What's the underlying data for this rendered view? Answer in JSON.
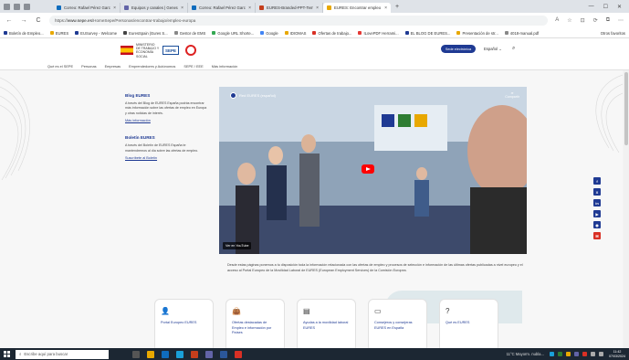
{
  "browser": {
    "tabs": [
      {
        "label": "Correo: Rafael Pérez García - Ou",
        "color": "#0f6cbd"
      },
      {
        "label": "Equipos y canales | General | Mi",
        "color": "#6264a7"
      },
      {
        "label": "Correo: Rafael Pérez García - Ou",
        "color": "#0f6cbd"
      },
      {
        "label": "EURES-Branded-PPT-Template-E",
        "color": "#c43e1c"
      },
      {
        "label": "EURES: Encontrar empleo en Eur",
        "color": "#e8a800",
        "active": true
      }
    ],
    "new_tab": "+",
    "window_controls": [
      "—",
      "☐",
      "✕"
    ],
    "nav": {
      "back": "←",
      "forward": "→",
      "reload": "C"
    },
    "url_prefix": "https://",
    "url_domain": "www.sepe.es",
    "url_path": "/HomeSepe/Personas/encontrar-trabajo/empleo-europa",
    "addr_icons": [
      "A",
      "☆",
      "⊡",
      "⟳",
      "⧉",
      "⋯"
    ],
    "bookmarks": [
      {
        "label": "Boletín de Empleo...",
        "color": "#1f3a93"
      },
      {
        "label": "EURES",
        "color": "#e8a800"
      },
      {
        "label": "EUSurvey - Welcome",
        "color": "#1f3a93"
      },
      {
        "label": "EuresSpain (Eures S...",
        "color": "#444"
      },
      {
        "label": "Gestor de EMS",
        "color": "#888"
      },
      {
        "label": "Google URL Shorte...",
        "color": "#34a853"
      },
      {
        "label": "Google",
        "color": "#4285f4"
      },
      {
        "label": "IDIOMAS",
        "color": "#e8a800"
      },
      {
        "label": "Ofertas de trabajo...",
        "color": "#d93025"
      },
      {
        "label": "ILovePDF Herrami...",
        "color": "#e53935"
      },
      {
        "label": "EL BLOG DE EURES...",
        "color": "#1f3a93"
      },
      {
        "label": "Presentación de str...",
        "color": "#e8a800"
      },
      {
        "label": "4018-manual.pdf",
        "color": "#888"
      }
    ],
    "bookmarks_more": "Otros favoritos"
  },
  "site": {
    "ministry_text": "MINISTERIO DE TRABAJO Y ECONOMÍA SOCIAL",
    "sepe_logo": "SEPE",
    "sede_button": "Sede electrónica",
    "language": "Español",
    "nav": [
      "Qué es el SEPE",
      "Personas",
      "Empresas",
      "Emprendedores y Autónomos",
      "SEPE / EEE",
      "Más información"
    ]
  },
  "content": {
    "blog": {
      "title": "Blog EURES",
      "text": "A través del Blog de EURES España podrás encontrar más información sobre las ofertas de empleo en Europa y otras noticias de interés.",
      "link": "Más información"
    },
    "boletin": {
      "title": "Boletín EURES",
      "text": "A través del Boletín de EURES España te mantendremos al día sobre las ofertas de empleo.",
      "link": "Suscríbete al Boletín"
    },
    "video": {
      "title": "Red EURES (español)",
      "share": "Compartir",
      "watch_on": "Ver en YouTube"
    },
    "intro": "Desde estas páginas ponemos a tu disposición toda la información relacionada con las ofertas de empleo y procesos de selección e información de las últimas ofertas publicadas a nivel europeo y el acceso al Portal Europeo de la Movilidad Laboral de EURES (European Employment Services) de la Comisión Europea.",
    "social": [
      {
        "icon": "facebook-icon",
        "glyph": "f",
        "color": "#1f3a93"
      },
      {
        "icon": "x-icon",
        "glyph": "X",
        "color": "#1f3a93"
      },
      {
        "icon": "linkedin-icon",
        "glyph": "in",
        "color": "#1f3a93"
      },
      {
        "icon": "youtube-icon",
        "glyph": "▶",
        "color": "#1f3a93"
      },
      {
        "icon": "rss-icon",
        "glyph": "◉",
        "color": "#1f3a93"
      },
      {
        "icon": "subscribe-icon",
        "glyph": "✉",
        "color": "#d93025"
      }
    ],
    "cards": [
      {
        "icon": "user-add-icon",
        "glyph": "👤",
        "label": "Portal Europeo EURES"
      },
      {
        "icon": "bag-icon",
        "glyph": "👜",
        "label": "Ofertas destacadas de Empleo e información por Países"
      },
      {
        "icon": "document-icon",
        "glyph": "▤",
        "label": "Ayudas a la movilidad laboral EURES"
      },
      {
        "icon": "folder-icon",
        "glyph": "▭",
        "label": "Consejeros y consejeras EURES en España"
      },
      {
        "icon": "question-icon",
        "glyph": "?",
        "label": "Qué es EURES"
      }
    ]
  },
  "taskbar": {
    "search_placeholder": "Escribe aquí para buscar",
    "weather": "11°C Mayorm. nubla...",
    "time": "11:42",
    "date": "07/03/2024"
  }
}
